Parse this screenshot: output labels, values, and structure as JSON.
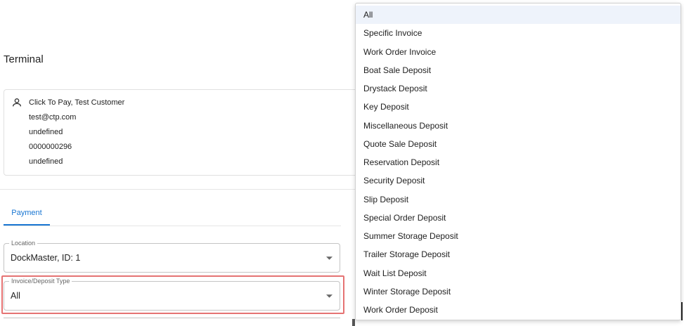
{
  "page_title": "Terminal",
  "customer": {
    "name": "Click To Pay, Test Customer",
    "email": "test@ctp.com",
    "line3": "undefined",
    "account": "0000000296",
    "line5": "undefined"
  },
  "tabs": [
    {
      "label": "Payment"
    }
  ],
  "location_field": {
    "label": "Location",
    "value": "DockMaster, ID: 1"
  },
  "invoice_type_field": {
    "label": "Invoice/Deposit Type",
    "value": "All"
  },
  "dropdown": {
    "selected": "All",
    "options": [
      "All",
      "Specific Invoice",
      "Work Order Invoice",
      "Boat Sale Deposit",
      "Drystack Deposit",
      "Key Deposit",
      "Miscellaneous Deposit",
      "Quote Sale Deposit",
      "Reservation Deposit",
      "Security Deposit",
      "Slip Deposit",
      "Special Order Deposit",
      "Summer Storage Deposit",
      "Trailer Storage Deposit",
      "Wait List Deposit",
      "Winter Storage Deposit",
      "Work Order Deposit"
    ]
  },
  "colors": {
    "accent": "#1976d2",
    "highlight": "#e57373",
    "selected_bg": "#eef3fb"
  },
  "icons": {
    "customer": "person-icon",
    "select": "chevron-down-icon"
  }
}
